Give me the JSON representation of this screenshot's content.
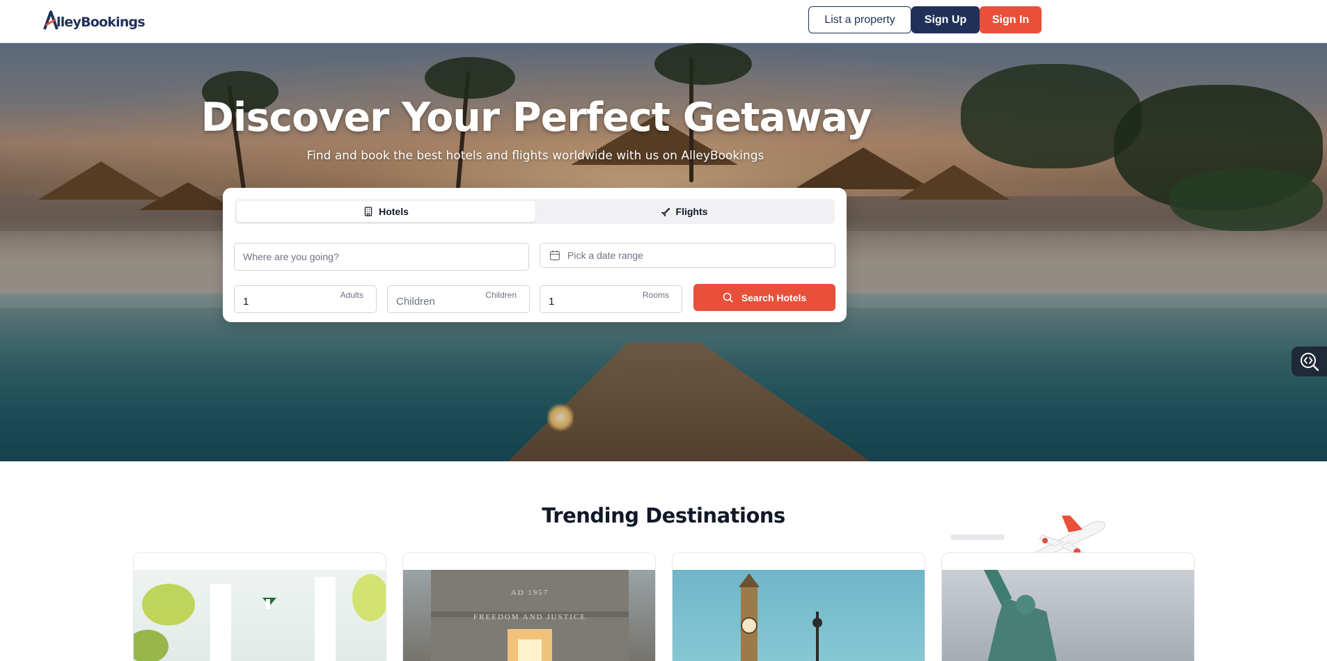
{
  "brand": {
    "name": "AlleyBookings",
    "logo_text": "lleyBookings",
    "primary_color": "#1f3159",
    "accent_color": "#e8503a"
  },
  "header": {
    "list_property": "List a property",
    "sign_up": "Sign Up",
    "sign_in": "Sign In"
  },
  "hero": {
    "title": "Discover Your Perfect Getaway",
    "subtitle": "Find and book the best hotels and flights worldwide with us on AlleyBookings"
  },
  "search": {
    "tabs": [
      {
        "label": "Hotels",
        "icon": "building-icon",
        "active": true
      },
      {
        "label": "Flights",
        "icon": "plane-icon",
        "active": false
      }
    ],
    "destination_placeholder": "Where are you going?",
    "date_placeholder": "Pick a date range",
    "adults": {
      "value": "1",
      "tag": "Adults"
    },
    "children": {
      "placeholder": "Children",
      "tag": "Children"
    },
    "rooms": {
      "value": "1",
      "tag": "Rooms"
    },
    "button": "Search Hotels"
  },
  "trending": {
    "title": "Trending Destinations",
    "cards": [
      {
        "image": "abuja-monument",
        "caption": ""
      },
      {
        "image": "independence-arch",
        "caption": ""
      },
      {
        "image": "big-ben",
        "caption": ""
      },
      {
        "image": "statue-of-liberty",
        "caption": ""
      }
    ],
    "arch_inscription_top": "AD 1957",
    "arch_inscription": "FREEDOM AND JUSTICE"
  }
}
